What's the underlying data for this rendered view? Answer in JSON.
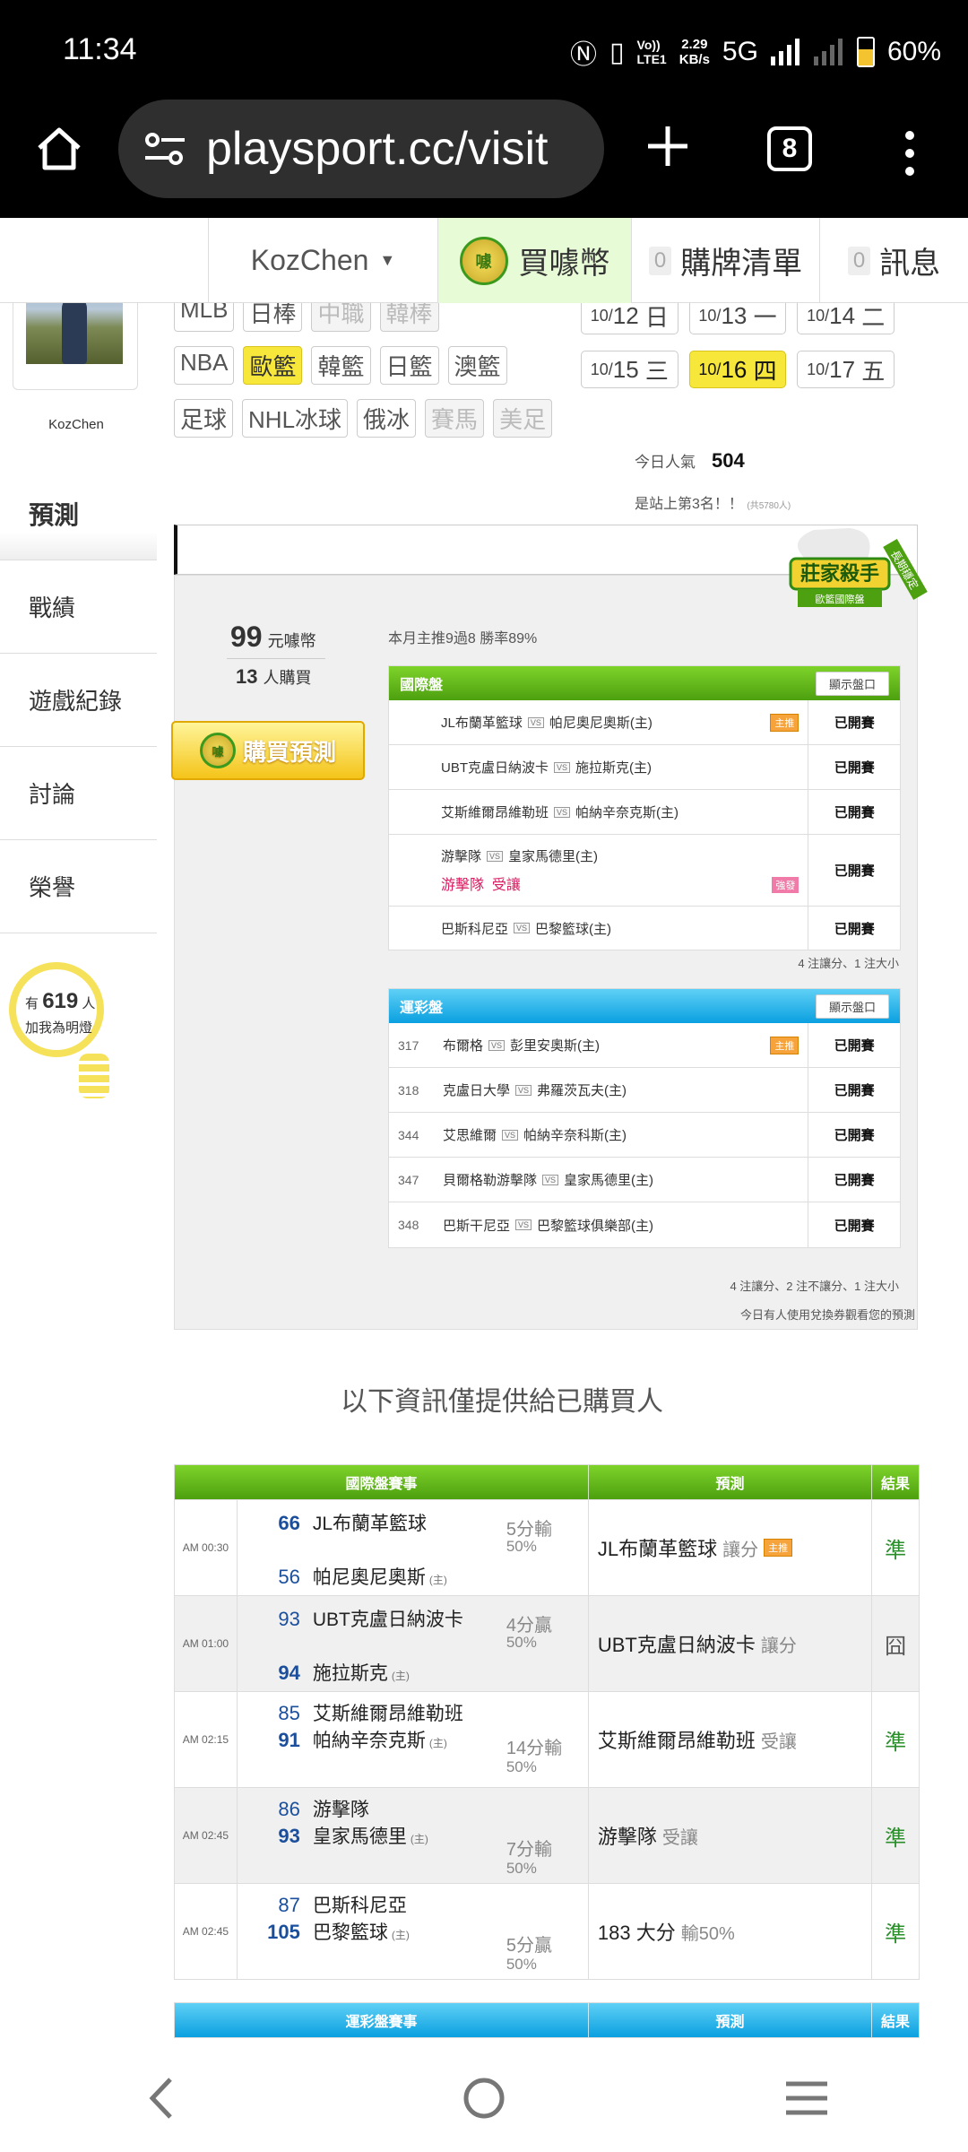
{
  "status_bar": {
    "time": "11:34",
    "network_speed_value": "2.29",
    "network_speed_unit": "KB/s",
    "volte_top": "Vo))",
    "volte_bottom": "LTE1",
    "network": "5G",
    "battery": "60%",
    "battery_level": 0.6
  },
  "browser": {
    "url": "playsport.cc/visit",
    "tabs_count": "8"
  },
  "topnav": {
    "username": "KozChen",
    "buy_coins_label": "買噱幣",
    "coin_icon_text": "噱",
    "purchase_list_count": "0",
    "purchase_list_label": "購牌清單",
    "messages_count": "0",
    "messages_label": "訊息"
  },
  "sidebar": {
    "username": "KozChen",
    "items": [
      {
        "label": "預測"
      },
      {
        "label": "戰績"
      },
      {
        "label": "遊戲紀錄"
      },
      {
        "label": "討論"
      },
      {
        "label": "榮譽"
      }
    ],
    "fans_prefix": "有",
    "fans_count": "619",
    "fans_suffix": "人",
    "fans_cta": "加我為明燈"
  },
  "leagues": {
    "row1": [
      "MLB",
      "日棒",
      "中職",
      "韓棒"
    ],
    "row2": [
      "NBA",
      "歐籃",
      "韓籃",
      "日籃",
      "澳籃"
    ],
    "row3": [
      "足球",
      "NHL冰球",
      "俄冰",
      "賽馬",
      "美足"
    ]
  },
  "dates": [
    {
      "month": "10/",
      "day": "12",
      "weekday": "日"
    },
    {
      "month": "10/",
      "day": "13",
      "weekday": "一"
    },
    {
      "month": "10/",
      "day": "14",
      "weekday": "二"
    },
    {
      "month": "10/",
      "day": "15",
      "weekday": "三"
    },
    {
      "month": "10/",
      "day": "16",
      "weekday": "四"
    },
    {
      "month": "10/",
      "day": "17",
      "weekday": "五"
    }
  ],
  "popularity": {
    "label": "今日人氣",
    "value": "504",
    "rank_text": "是站上第3名！！",
    "rank_total": "(共5780人)"
  },
  "badge": {
    "title": "莊家殺手",
    "subtitle": "歐籃國際盤",
    "ribbon": "長期穩定"
  },
  "prediction": {
    "price": "99",
    "price_unit": "元噱幣",
    "buyers": "13",
    "buyers_unit": "人購買",
    "buy_button": "購買預測",
    "monthly_record": "本月主推9過8 勝率89%",
    "intl_title": "國際盤",
    "lottery_title": "運彩盤",
    "show_button": "顯示盤口",
    "vs": "VS",
    "main_tag": "主推",
    "pick_tag": "強發",
    "status": "已開賽",
    "intl_games": [
      {
        "away": "JL布蘭革籃球",
        "home": "帕尼奧尼奧斯(主)"
      },
      {
        "away": "UBT克盧日納波卡",
        "home": "施拉斯克(主)"
      },
      {
        "away": "艾斯維爾昂維勒班",
        "home": "帕納辛奈克斯(主)"
      },
      {
        "away": "游擊隊",
        "home": "皇家馬德里(主)",
        "pick": "游擊隊",
        "pick_type": "受讓"
      },
      {
        "away": "巴斯科尼亞",
        "home": "巴黎籃球(主)"
      }
    ],
    "intl_summary": "4 注讓分、1 注大小",
    "lottery_games": [
      {
        "num": "317",
        "away": "布爾格",
        "home": "彭里安奧斯(主)"
      },
      {
        "num": "318",
        "away": "克盧日大學",
        "home": "弗羅茨瓦夫(主)"
      },
      {
        "num": "344",
        "away": "艾思維爾",
        "home": "帕納辛奈科斯(主)"
      },
      {
        "num": "347",
        "away": "貝爾格勒游擊隊",
        "home": "皇家馬德里(主)"
      },
      {
        "num": "348",
        "away": "巴斯干尼亞",
        "home": "巴黎籃球俱樂部(主)"
      }
    ],
    "lottery_summary": "4 注讓分、2 注不讓分、1 注大小",
    "exchange_note": "今日有人使用兌換券觀看您的預測"
  },
  "results": {
    "section_title": "以下資訊僅提供給已購買人",
    "intl_header": [
      "國際盤賽事",
      "預測",
      "結果"
    ],
    "lottery_header": [
      "運彩盤賽事",
      "預測",
      "結果"
    ],
    "home_mark": "(主)",
    "rows": [
      {
        "time": "AM 00:30",
        "away_score": "66",
        "away": "JL布蘭革籃球",
        "home_score": "56",
        "home": "帕尼奧尼奧斯",
        "line1": "5分輸",
        "line2": "50%",
        "pred": "JL布蘭革籃球",
        "pred_type": "讓分",
        "main": true,
        "result": "準"
      },
      {
        "time": "AM 01:00",
        "away_score": "93",
        "away": "UBT克盧日納波卡",
        "home_score": "94",
        "home": "施拉斯克",
        "line1": "4分贏",
        "line2": "50%",
        "pred": "UBT克盧日納波卡",
        "pred_type": "讓分",
        "main": false,
        "result": "囧"
      },
      {
        "time": "AM 02:15",
        "away_score": "85",
        "away": "艾斯維爾昂維勒班",
        "home_score": "91",
        "home": "帕納辛奈克斯",
        "line1": "14分輸",
        "line2": "50%",
        "pred": "艾斯維爾昂維勒班",
        "pred_type": "受讓",
        "main": false,
        "result": "準"
      },
      {
        "time": "AM 02:45",
        "away_score": "86",
        "away": "游擊隊",
        "home_score": "93",
        "home": "皇家馬德里",
        "line1": "7分輸",
        "line2": "50%",
        "pred": "游擊隊",
        "pred_type": "受讓",
        "main": false,
        "result": "準"
      },
      {
        "time": "AM 02:45",
        "away_score": "87",
        "away": "巴斯科尼亞",
        "home_score": "105",
        "home": "巴黎籃球",
        "line1": "5分贏",
        "line2": "50%",
        "pred": "183 大分",
        "pred_type": "輸50%",
        "main": false,
        "result": "準"
      }
    ]
  },
  "colors": {
    "green": "#4da00f",
    "blue": "#0aa0e0",
    "yellow": "#f7e73a",
    "correct": "#2a8f2a"
  }
}
